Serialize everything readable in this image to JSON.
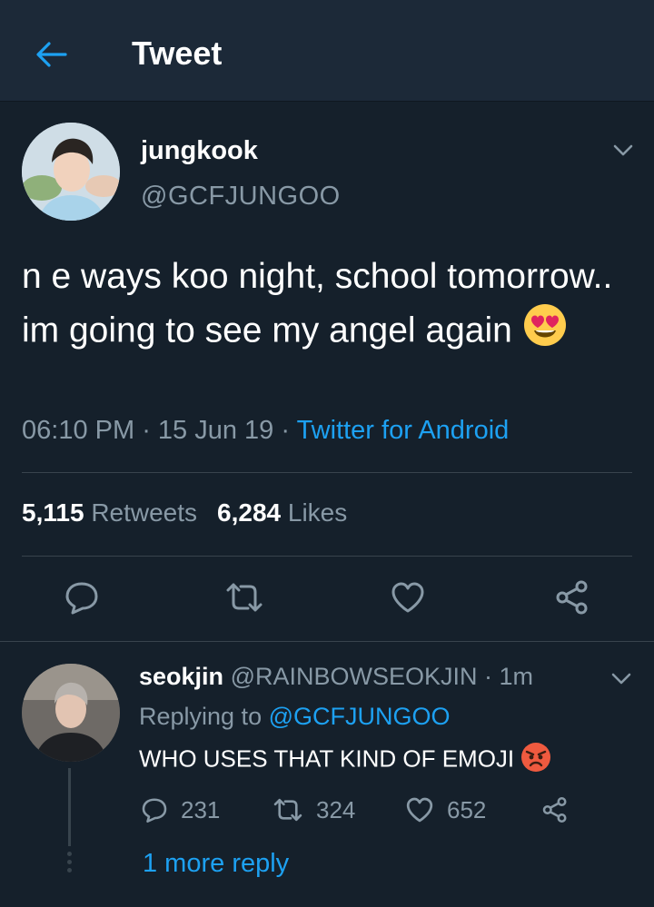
{
  "header": {
    "title": "Tweet",
    "back_icon": "arrow-left-icon"
  },
  "tweet": {
    "display_name": "jungkook",
    "handle": "@GCFJUNGOO",
    "text": "n e ways koo night, school tomorrow.. im going to see my angel again",
    "emoji": "heart-eyes-emoji",
    "time": "06:10 PM",
    "date": "15 Jun 19",
    "separator": " · ",
    "source": "Twitter for Android",
    "retweet_count": "5,115",
    "retweet_label": "Retweets",
    "like_count": "6,284",
    "like_label": "Likes"
  },
  "reply": {
    "display_name": "seokjin",
    "handle": "@RAINBOWSEOKJIN",
    "age": " · 1m",
    "replying_prefix": "Replying to ",
    "replying_to": "@GCFJUNGOO",
    "text": "WHO USES THAT KIND OF EMOJI",
    "emoji": "angry-face-emoji",
    "reply_count": "231",
    "retweet_count": "324",
    "like_count": "652"
  },
  "more_replies": "1 more reply",
  "colors": {
    "background": "#15202b",
    "header": "#1c2938",
    "accent": "#1da1f2",
    "muted": "#8899a6",
    "divider": "#38444d"
  }
}
